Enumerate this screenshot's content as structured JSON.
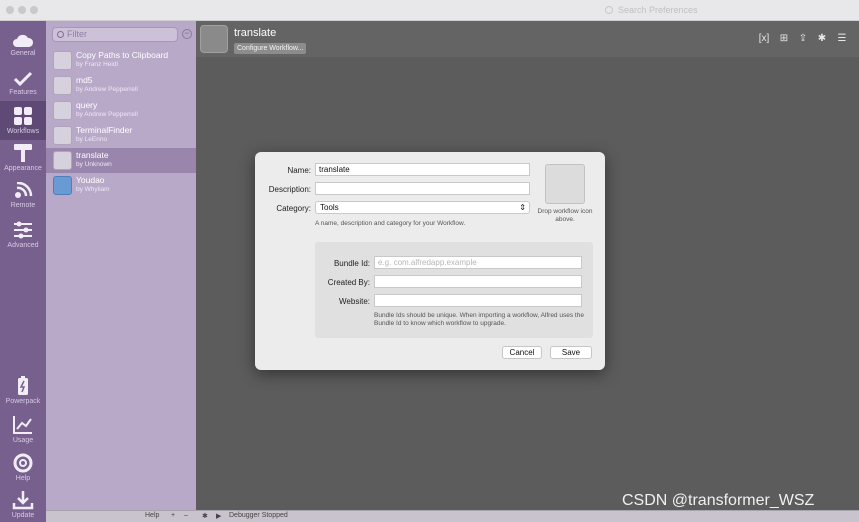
{
  "titlebar": {
    "search_placeholder": "Search Preferences"
  },
  "rail": {
    "items": [
      {
        "label": "General",
        "icon": "cloud-icon"
      },
      {
        "label": "Features",
        "icon": "checkmark-icon"
      },
      {
        "label": "Workflows",
        "icon": "grid-icon"
      },
      {
        "label": "Appearance",
        "icon": "paint-roller-icon"
      },
      {
        "label": "Remote",
        "icon": "wifi-icon"
      },
      {
        "label": "Advanced",
        "icon": "sliders-icon"
      },
      {
        "label": "Powerpack",
        "icon": "battery-icon"
      },
      {
        "label": "Usage",
        "icon": "chart-icon"
      },
      {
        "label": "Help",
        "icon": "lifebuoy-icon"
      },
      {
        "label": "Update",
        "icon": "download-icon"
      }
    ]
  },
  "list": {
    "filter_placeholder": "Filter",
    "workflows": [
      {
        "name": "Copy Paths to Clipboard",
        "author": "by Franz Heidl"
      },
      {
        "name": "md5",
        "author": "by Andrew Pepperrell"
      },
      {
        "name": "query",
        "author": "by Andrew Pepperrell"
      },
      {
        "name": "TerminalFinder",
        "author": "by LeEnno"
      },
      {
        "name": "translate",
        "author": "by Unknown"
      },
      {
        "name": "Youdao",
        "author": "by Whyliam"
      }
    ]
  },
  "bottombar": {
    "help": "Help",
    "plus": "+",
    "minus": "–",
    "debugger": "Debugger Stopped"
  },
  "canvas": {
    "title": "translate",
    "configure_label": "Configure Workflow..."
  },
  "dialog": {
    "name_label": "Name:",
    "name_value": "translate",
    "description_label": "Description:",
    "description_value": "",
    "category_label": "Category:",
    "category_value": "Tools",
    "category_hint": "A name, description and category for your Workflow.",
    "drop_hint": "Drop workflow icon above.",
    "bundle_label": "Bundle Id:",
    "bundle_placeholder": "e.g. com.alfredapp.example",
    "createdby_label": "Created By:",
    "createdby_value": "",
    "website_label": "Website:",
    "website_value": "",
    "bundle_hint": "Bundle Ids should be unique. When importing a workflow, Alfred uses the Bundle Id to know which workflow to upgrade.",
    "cancel_label": "Cancel",
    "save_label": "Save"
  },
  "watermark": "CSDN @transformer_WSZ",
  "colors": {
    "rail": "#77608e",
    "list": "#b9a9c9",
    "selected": "#9a86ad",
    "canvas": "#5c5c5c"
  }
}
